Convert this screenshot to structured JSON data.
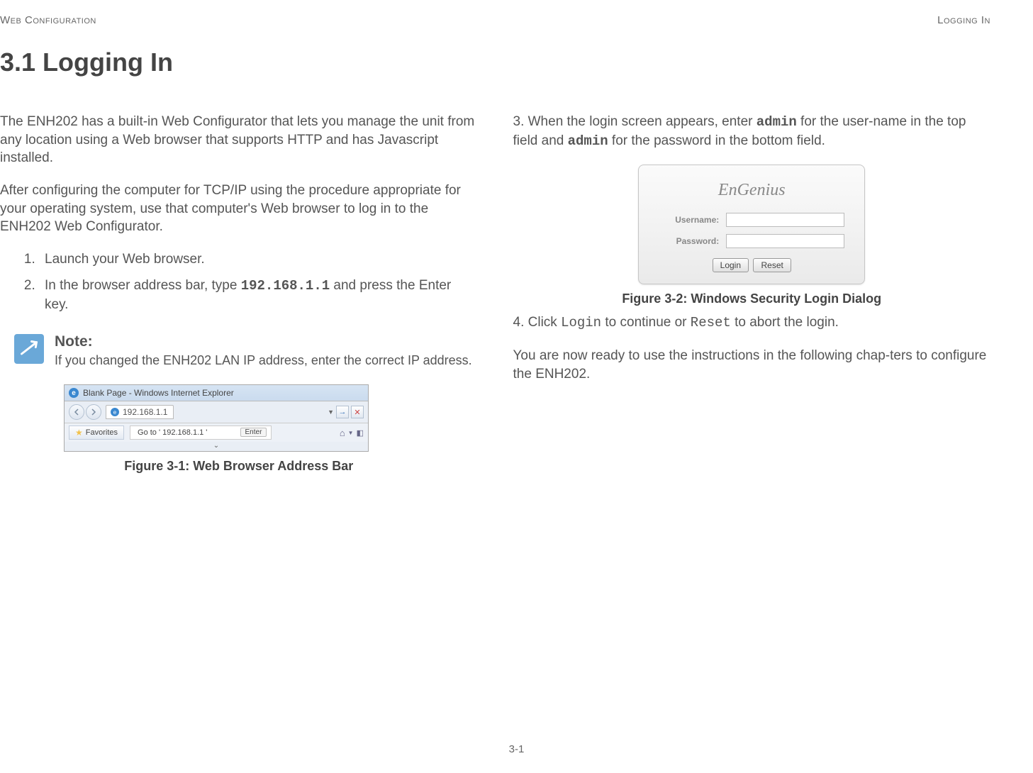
{
  "header": {
    "left": "Web Configuration",
    "right": "Logging In"
  },
  "section_title": "3.1 Logging In",
  "left_col": {
    "p1": "The ENH202 has a built-in Web Configurator that lets you manage the unit from any location using a Web browser that supports HTTP and has Javascript installed.",
    "p2": "After configuring the computer for TCP/IP using the procedure appropriate for your operating system, use that computer's Web browser to log in to the ENH202 Web Configurator.",
    "step1": "Launch your Web browser.",
    "step2_a": "In the browser address bar, type ",
    "step2_ip": "192.168.1.1",
    "step2_b": " and press the Enter key.",
    "note_title": "Note:",
    "note_body": "If you changed the ENH202 LAN IP address, enter the correct IP address.",
    "fig1_caption": "Figure 3-1: Web Browser Address Bar",
    "browser": {
      "title": "Blank Page - Windows Internet Explorer",
      "url": "192.168.1.1",
      "goto": "Go to ' 192.168.1.1 '",
      "enter": "Enter",
      "favorites": "Favorites"
    }
  },
  "right_col": {
    "p3_a": "3. When the login screen appears, enter ",
    "p3_admin1": "admin",
    "p3_b": " for the user-name in the top field and ",
    "p3_admin2": "admin",
    "p3_c": " for the password in the bottom field.",
    "login": {
      "brand": "EnGenius",
      "username_label": "Username:",
      "password_label": "Password:",
      "login_btn": "Login",
      "reset_btn": "Reset"
    },
    "fig2_caption": "Figure 3-2: Windows Security Login Dialog",
    "p4_a": "4. Click ",
    "p4_login": "Login",
    "p4_b": " to continue or ",
    "p4_reset": "Reset",
    "p4_c": " to abort the login.",
    "p5": "You are now ready to use the instructions in the following chap-ters to configure the ENH202."
  },
  "footer": "3-1"
}
